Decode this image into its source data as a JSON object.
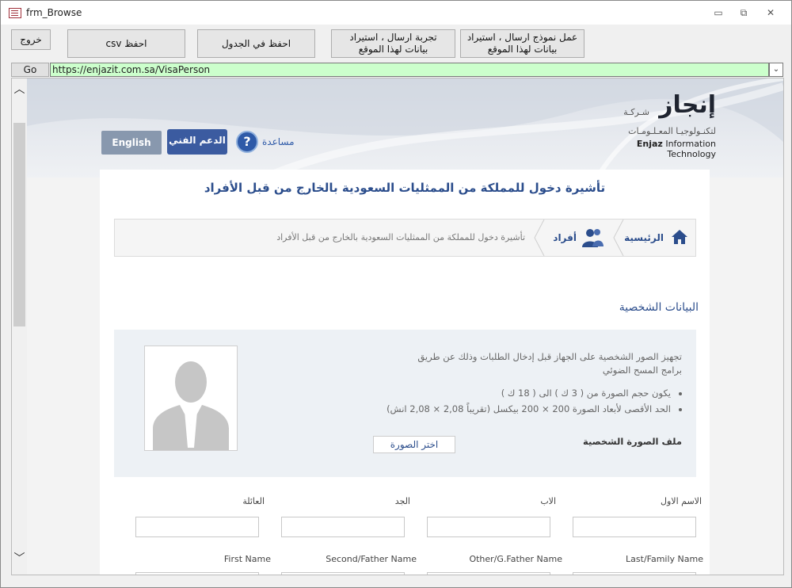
{
  "window": {
    "title": "frm_Browse",
    "minimize_glyph": "▭",
    "restore_glyph": "⧉",
    "close_glyph": "✕"
  },
  "toolbar": {
    "exit_label": "خروج",
    "save_csv_label": "احفظ csv",
    "save_table_label": "احفظ في الجدول",
    "test_send_label": "تجربة ارسال ، استيراد\nبيانات لهذا الموقع",
    "make_model_label": "عمل نموذج ارسال ، استيراد\nبيانات لهذا الموقع"
  },
  "address": {
    "go_label": "Go",
    "url": "https://enjazit.com.sa/VisaPerson",
    "dropdown_glyph": "⌄"
  },
  "scrollbar": {
    "up_glyph": "︿",
    "down_glyph": "﹀"
  },
  "header": {
    "logo_arabic": "إنجاز",
    "logo_company_small": "شـركـة",
    "logo_subtitle": "لتكنـولوجيـا المعـلـومـات",
    "logo_english_bold": "Enjaz",
    "logo_english_rest": " Information Technology",
    "english_button": "English",
    "support_button": "الدعم الفني",
    "help_glyph": "?",
    "help_label": "مساعدة"
  },
  "page": {
    "title": "تأشيرة دخول للمملكة من الممثليات السعودية بالخارج من قبل الأفراد",
    "breadcrumb": {
      "home": "الرئيسية",
      "individuals": "أفراد",
      "current": "تأشيرة دخول للمملكة من الممثليات السعودية بالخارج من قبل الأفراد"
    },
    "section_title": "البيانات الشخصية",
    "photo": {
      "instructions": "تجهيز الصور الشخصية على الجهاز قبل إدخال الطلبات وذلك عن طريق برامج المسح الضوئي",
      "bullets": [
        "يكون حجم الصورة من ( 3 ك ) الى ( 18 ك )",
        "الحد الأقصى لأبعاد الصورة 200 × 200 بيكسل (تقريباً 2,08 × 2,08 انش)"
      ],
      "file_label": "ملف الصورة الشخصية",
      "choose_button": "اختر الصورة"
    },
    "form": {
      "arabic_labels": [
        "الاسم الاول",
        "الاب",
        "الجد",
        "العائلة"
      ],
      "english_labels": [
        "Last/Family Name",
        "Other/G.Father Name",
        "Second/Father Name",
        "First Name"
      ]
    }
  }
}
